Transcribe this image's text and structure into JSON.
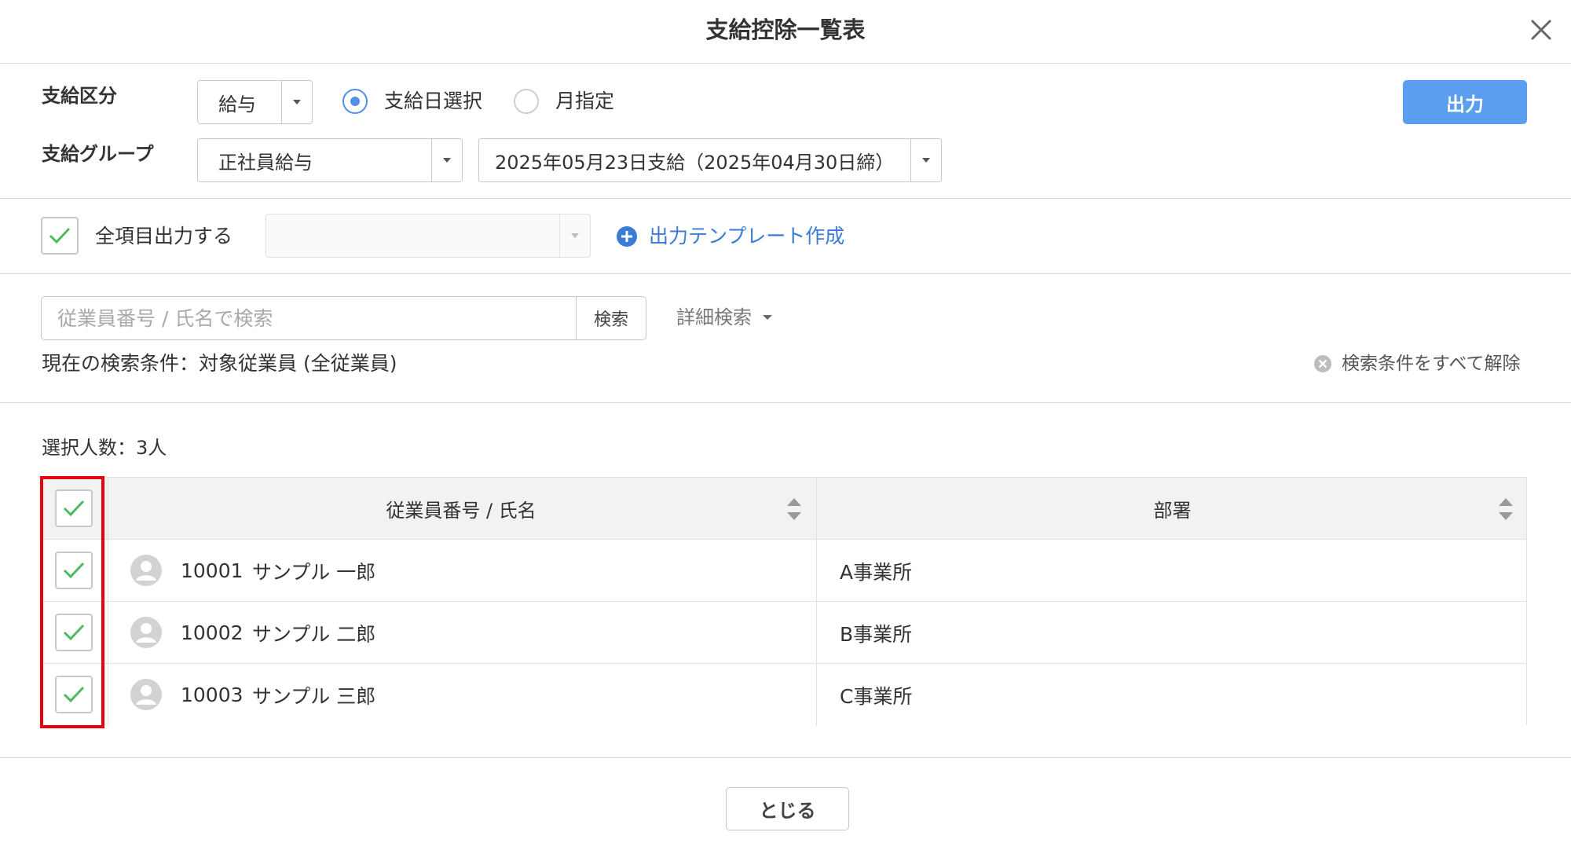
{
  "dialog": {
    "title": "支給控除一覧表"
  },
  "filters": {
    "pay_type_label": "支給区分",
    "pay_type_value": "給与",
    "radio_pay_date": "支給日選択",
    "radio_month": "月指定",
    "pay_group_label": "支給グループ",
    "pay_group_value": "正社員給与",
    "pay_date_value": "2025年05月23日支給（2025年04月30日締）",
    "output_button": "出力"
  },
  "options": {
    "all_items_label": "全項目出力する",
    "template_select_value": "",
    "create_template_link": "出力テンプレート作成"
  },
  "search": {
    "placeholder": "従業員番号 / 氏名で検索",
    "button": "検索",
    "advanced": "詳細検索",
    "current_conditions": "現在の検索条件：対象従業員 (全従業員)",
    "clear_all": "検索条件をすべて解除"
  },
  "selection": {
    "count_label": "選択人数：3人"
  },
  "table": {
    "columns": [
      "従業員番号 / 氏名",
      "部署"
    ],
    "rows": [
      {
        "id": "10001",
        "name": "サンプル 一郎",
        "dept": "A事業所"
      },
      {
        "id": "10002",
        "name": "サンプル 二郎",
        "dept": "B事業所"
      },
      {
        "id": "10003",
        "name": "サンプル 三郎",
        "dept": "C事業所"
      }
    ]
  },
  "footer": {
    "close_button": "とじる"
  },
  "colors": {
    "accent": "#5b9ef0",
    "link": "#3a7bd5",
    "check": "#4cbb5f",
    "highlight": "#e8000d"
  }
}
